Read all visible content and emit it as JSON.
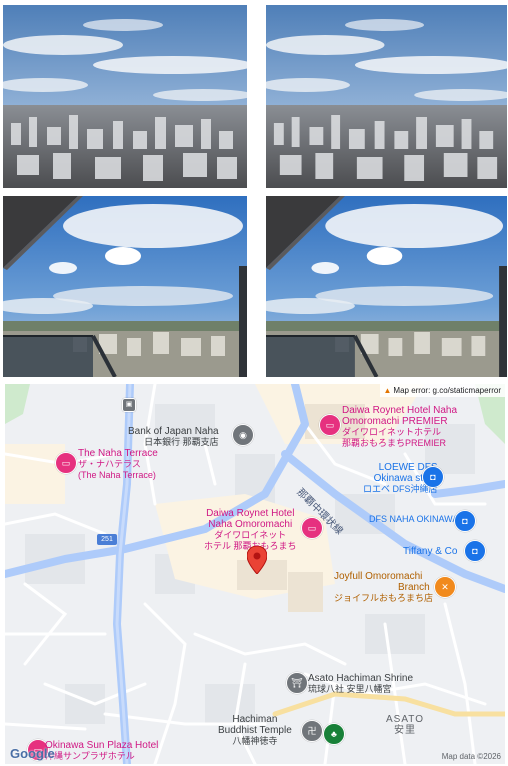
{
  "photos": [
    {
      "alt": "Naha city skyline under cloudy sky"
    },
    {
      "alt": "Naha city skyline under cloudy sky"
    },
    {
      "alt": "View from balcony over Naha"
    },
    {
      "alt": "View from balcony over Naha"
    }
  ],
  "map": {
    "error_text": "Map error: g.co/staticmaperror",
    "attribution": "Map data ©2026",
    "google_logo": "Google",
    "route_badge": "251",
    "road_name": "那覇中環状線",
    "area_name_en": "ASATO",
    "area_name_ja": "安里",
    "colors": {
      "hotel_pin": "#e6317f",
      "shop_pin": "#1a73e8",
      "food_pin": "#f18a1d",
      "selected_pin": "#ea4335",
      "road_major": "#aecbfa"
    },
    "places": {
      "bank": {
        "name": "Bank of Japan Naha",
        "name_ja": "日本銀行 那覇支店"
      },
      "daiwa_premier": {
        "name1": "Daiwa Roynet Hotel Naha",
        "name2": "Omoromachi PREMIER",
        "name_ja1": "ダイワロイネットホテル",
        "name_ja2": "那覇おもろまちPREMIER"
      },
      "naha_terrace": {
        "name": "The Naha Terrace",
        "name_ja1": "ザ・ナハテラス",
        "name_ja2": "(The Naha Terrace)"
      },
      "loewe": {
        "name1": "LOEWE DFS",
        "name2": "Okinawa store",
        "name_ja": "ロエベ DFS沖縄店"
      },
      "dfs": {
        "name": "DFS NAHA OKINAWA"
      },
      "daiwa_omoro": {
        "name1": "Daiwa Roynet Hotel",
        "name2": "Naha Omoromachi",
        "name_ja1": "ダイワロイネット",
        "name_ja2": "ホテル 那覇おもろまち"
      },
      "tiffany": {
        "name": "Tiffany & Co"
      },
      "joyfull": {
        "name1": "Joyfull Omoromachi",
        "name2": "Branch",
        "name_ja": "ジョイフルおもろまち店"
      },
      "asato_shrine": {
        "name": "Asato Hachiman Shrine",
        "name_ja": "琉球八社 安里八幡宮"
      },
      "hachiman_temple": {
        "name1": "Hachiman",
        "name2": "Buddhist Temple",
        "name_ja": "八幡神徳寺"
      },
      "sun_plaza": {
        "name": "Okinawa Sun Plaza Hotel",
        "name_ja": "沖縄サンプラザホテル"
      }
    }
  }
}
